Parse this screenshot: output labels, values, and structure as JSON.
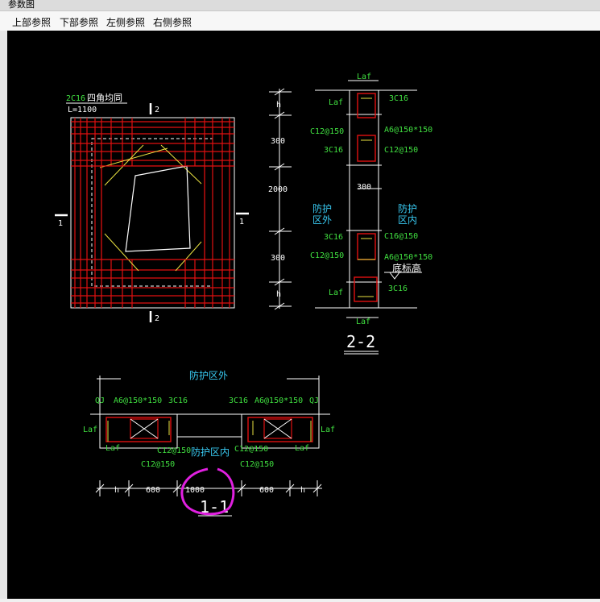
{
  "window": {
    "title": "参数图"
  },
  "menu": {
    "items": [
      {
        "label": "上部参照"
      },
      {
        "label": "下部参照"
      },
      {
        "label": "左侧参照"
      },
      {
        "label": "右侧参照"
      }
    ]
  },
  "drawing": {
    "plan": {
      "rebar_note": "2C16",
      "corner_note": "四角均同",
      "length_note": "L=1100",
      "section_mark_top": "2",
      "section_mark_bottom": "2",
      "section_mark_left": "1",
      "section_mark_right": "1"
    },
    "dims_vertical": {
      "h_top": "h",
      "d300_top": "300",
      "d2000": "2000",
      "d300_bottom": "300",
      "h_bottom": "h"
    },
    "section22": {
      "title": "2-2",
      "laf_top": "Laf",
      "laf_left_top": "Laf",
      "bar_3c16_top_right": "3C16",
      "c12_150_left_upper": "C12@150",
      "a6_top_right": "A6@150*150",
      "bar_3c16_left_upper": "3C16",
      "c12_150_right_upper": "C12@150",
      "d300": "300",
      "outside_zone_l1": "防护",
      "outside_zone_l2": "区外",
      "inside_zone_l1": "防护",
      "inside_zone_l2": "区内",
      "bar_3c16_left_lower": "3C16",
      "c16_150_right": "C16@150",
      "c12_150_left_lower": "C12@150",
      "a6_bottom_right": "A6@150*150",
      "floor_level": "底标高",
      "laf_left_bottom": "Laf",
      "bar_3c16_bottom_right": "3C16",
      "laf_bottom": "Laf"
    },
    "section11": {
      "title": "1-1",
      "outside_zone": "防护区外",
      "inside_zone": "防护区内",
      "qj_left": "QJ",
      "a6_left": "A6@150*150",
      "bar_3c16_left": "3C16",
      "bar_3c16_right": "3C16",
      "a6_right": "A6@150*150",
      "qj_right": "QJ",
      "laf_left": "Laf",
      "laf_right": "Laf",
      "laf_left_inner": "Laf",
      "laf_right_inner": "Laf",
      "c12_left_a": "C12@150",
      "c12_right_a": "C12@150",
      "c12_left_b": "C12@150",
      "c12_right_b": "C12@150",
      "dim_h_left": "h",
      "dim_600_left": "600",
      "dim_1000": "1000",
      "dim_600_right": "600",
      "dim_h_right": "h"
    }
  }
}
